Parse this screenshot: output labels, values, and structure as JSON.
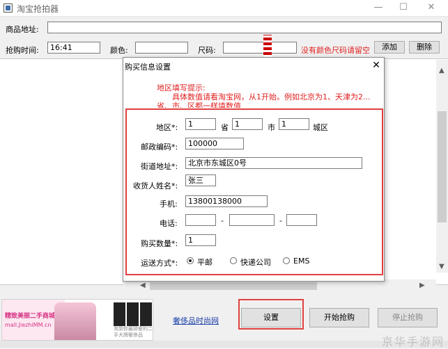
{
  "window": {
    "title": "淘宝抢拍器",
    "minimize": "—",
    "maximize": "☐",
    "close": "✕"
  },
  "main": {
    "url_label": "商品地址:",
    "url_value": "",
    "time_label": "抢购时间:",
    "time_value": "16:41",
    "color_label": "颜色:",
    "color_value": "",
    "size_label": "尺码:",
    "size_value": "",
    "warning": "没有颜色尺码请留空",
    "add_button": "添加",
    "delete_button": "删除"
  },
  "dialog": {
    "title": "购买信息设置",
    "close": "✕",
    "hint_line1": "地区填写提示:",
    "hint_line2": "具体数值请看淘宝网，从1开始。例如北京为1、天津为2...",
    "hint_line3": "省、市、区都一样填数值",
    "region_label": "地区*:",
    "province_value": "1",
    "province_unit": "省",
    "city_value": "1",
    "city_unit": "市",
    "district_value": "1",
    "district_unit": "城区",
    "zip_label": "邮政编码*:",
    "zip_value": "100000",
    "street_label": "街道地址*:",
    "street_value": "北京市东城区0号",
    "name_label": "收货人姓名*:",
    "name_value": "张三",
    "mobile_label": "手机:",
    "mobile_value": "13800138000",
    "phone_label": "电话:",
    "phone_sep1": "-",
    "phone_sep2": "-",
    "qty_label": "购买数量*:",
    "qty_value": "1",
    "ship_label": "运送方式*:",
    "ship_options": [
      "平邮",
      "快递公司",
      "EMS"
    ]
  },
  "footer": {
    "ad_line1": "精致美丽二手商城",
    "ad_line2": "mall.JiezhiMM.cn",
    "ad_small": "淘到你最钟爱的二手大牌奢侈品",
    "link": "奢侈品时尚网",
    "settings_button": "设置",
    "start_button": "开始抢购",
    "stop_button": "停止抢购",
    "watermark": "京华手游网"
  }
}
